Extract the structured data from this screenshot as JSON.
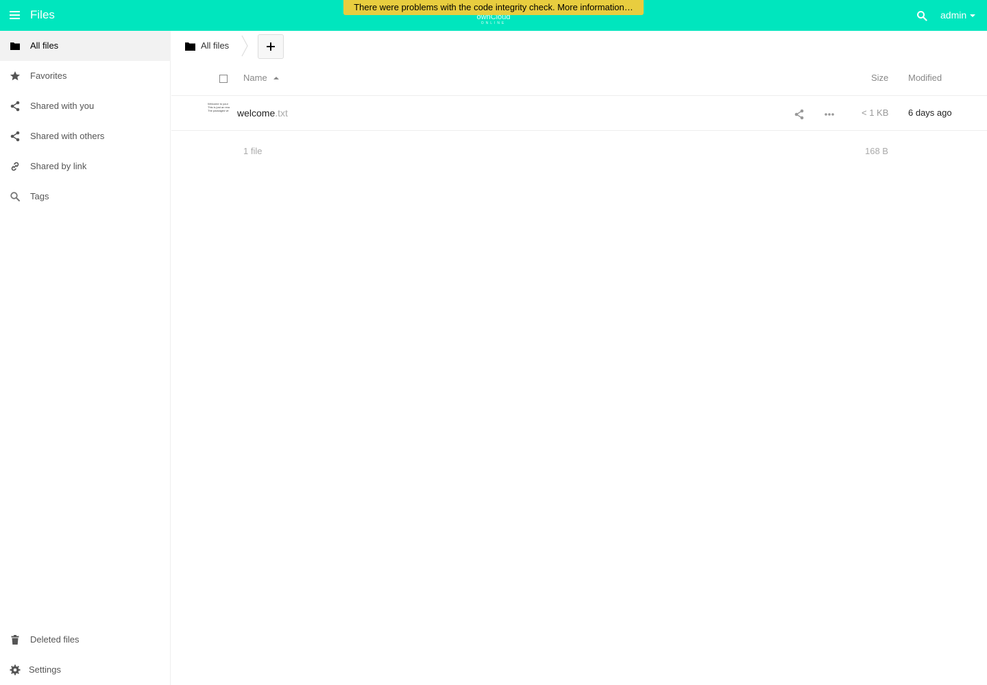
{
  "header": {
    "app_name": "Files",
    "logo_text": "ownCloud",
    "logo_subtext": "ONLINE",
    "integrity_warning": "There were problems with the code integrity check. More information…",
    "user": "admin",
    "bg_color": "#00e6be",
    "warning_color": "#e8cd3f"
  },
  "sidebar": {
    "items": [
      {
        "label": "All files",
        "icon": "folder-icon",
        "active": true
      },
      {
        "label": "Favorites",
        "icon": "star-icon"
      },
      {
        "label": "Shared with you",
        "icon": "share-icon"
      },
      {
        "label": "Shared with others",
        "icon": "share-icon"
      },
      {
        "label": "Shared by link",
        "icon": "link-icon"
      },
      {
        "label": "Tags",
        "icon": "search-icon"
      }
    ],
    "bottom": [
      {
        "label": "Deleted files",
        "icon": "trash-icon"
      },
      {
        "label": "Settings",
        "icon": "gear-icon"
      }
    ]
  },
  "breadcrumb": {
    "label": "All files",
    "new_label": "+"
  },
  "table": {
    "headers": {
      "name": "Name",
      "size": "Size",
      "modified": "Modified"
    },
    "rows": [
      {
        "thumb_lines": [
          "Welcome to your",
          "This is just an exa",
          "The packaged vir"
        ],
        "name": "welcome",
        "ext": ".txt",
        "size": "< 1 KB",
        "modified": "6 days ago"
      }
    ],
    "summary": {
      "count": "1 file",
      "size": "168 B"
    }
  }
}
